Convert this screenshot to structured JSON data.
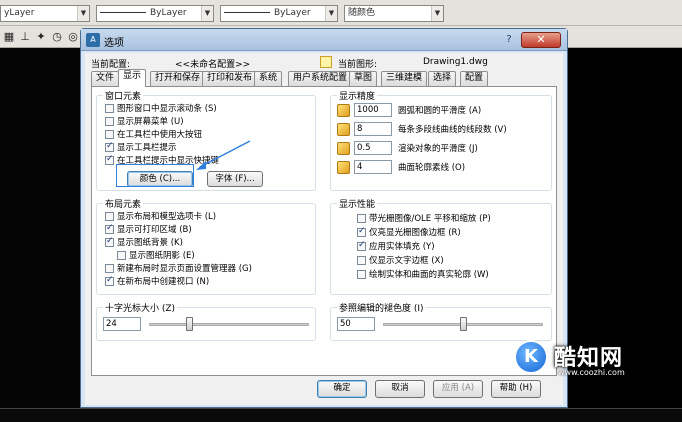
{
  "toolbar": {
    "layer_combo": "yLayer",
    "linetype_combo": "ByLayer",
    "lineweight_combo": "ByLayer",
    "color_combo": "随颜色",
    "icons": [
      "grid-icon",
      "snap-icon",
      "pin-icon",
      "clock-icon",
      "target-icon"
    ]
  },
  "dialog": {
    "title": "选项",
    "help_label": "?",
    "close_label": "✕",
    "profile_label": "当前配置:",
    "profile_value": "<<未命名配置>>",
    "drawing_label": "当前图形:",
    "drawing_value": "Drawing1.dwg",
    "tabs": [
      "文件",
      "显示",
      "打开和保存",
      "打印和发布",
      "系统",
      "用户系统配置",
      "草图",
      "三维建模",
      "选择",
      "配置"
    ],
    "active_tab": "显示"
  },
  "window_elements": {
    "title": "窗口元素",
    "items": [
      {
        "label": "图形窗口中显示滚动条 (S)",
        "checked": false
      },
      {
        "label": "显示屏幕菜单 (U)",
        "checked": false
      },
      {
        "label": "在工具栏中使用大按钮",
        "checked": false
      },
      {
        "label": "显示工具栏提示",
        "checked": true
      },
      {
        "label": "在工具栏提示中显示快捷键",
        "checked": true
      }
    ],
    "color_button": "颜色 (C)...",
    "font_button": "字体 (F)..."
  },
  "display_resolution": {
    "title": "显示精度",
    "items": [
      {
        "value": "1000",
        "label": "圆弧和圆的平滑度 (A)"
      },
      {
        "value": "8",
        "label": "每条多段线曲线的线段数 (V)"
      },
      {
        "value": "0.5",
        "label": "渲染对象的平滑度 (J)"
      },
      {
        "value": "4",
        "label": "曲面轮廓素线 (O)"
      }
    ]
  },
  "layout_elements": {
    "title": "布局元素",
    "items": [
      {
        "label": "显示布局和模型选项卡 (L)",
        "checked": false
      },
      {
        "label": "显示可打印区域 (B)",
        "checked": true
      },
      {
        "label": "显示图纸背景 (K)",
        "checked": true
      },
      {
        "label": "显示图纸阴影 (E)",
        "checked": false
      },
      {
        "label": "新建布局时显示页面设置管理器 (G)",
        "checked": false
      },
      {
        "label": "在新布局中创建视口 (N)",
        "checked": true
      }
    ]
  },
  "display_performance": {
    "title": "显示性能",
    "items": [
      {
        "label": "带光栅图像/OLE 平移和缩放 (P)",
        "checked": false
      },
      {
        "label": "仅亮显光栅图像边框 (R)",
        "checked": true
      },
      {
        "label": "应用实体填充 (Y)",
        "checked": true
      },
      {
        "label": "仅显示文字边框 (X)",
        "checked": false
      },
      {
        "label": "绘制实体和曲面的真实轮廓 (W)",
        "checked": false
      }
    ]
  },
  "crosshair": {
    "title": "十字光标大小 (Z)",
    "value": "24",
    "level_percent": 24
  },
  "reference_fade": {
    "title": "参照编辑的褪色度 (I)",
    "value": "50",
    "level_percent": 50
  },
  "footer": {
    "ok": "确定",
    "cancel": "取消",
    "apply": "应用 (A)",
    "help": "帮助 (H)"
  },
  "watermark": {
    "badge": "K",
    "title": "酷知网",
    "url": "www.coozhi.com"
  }
}
